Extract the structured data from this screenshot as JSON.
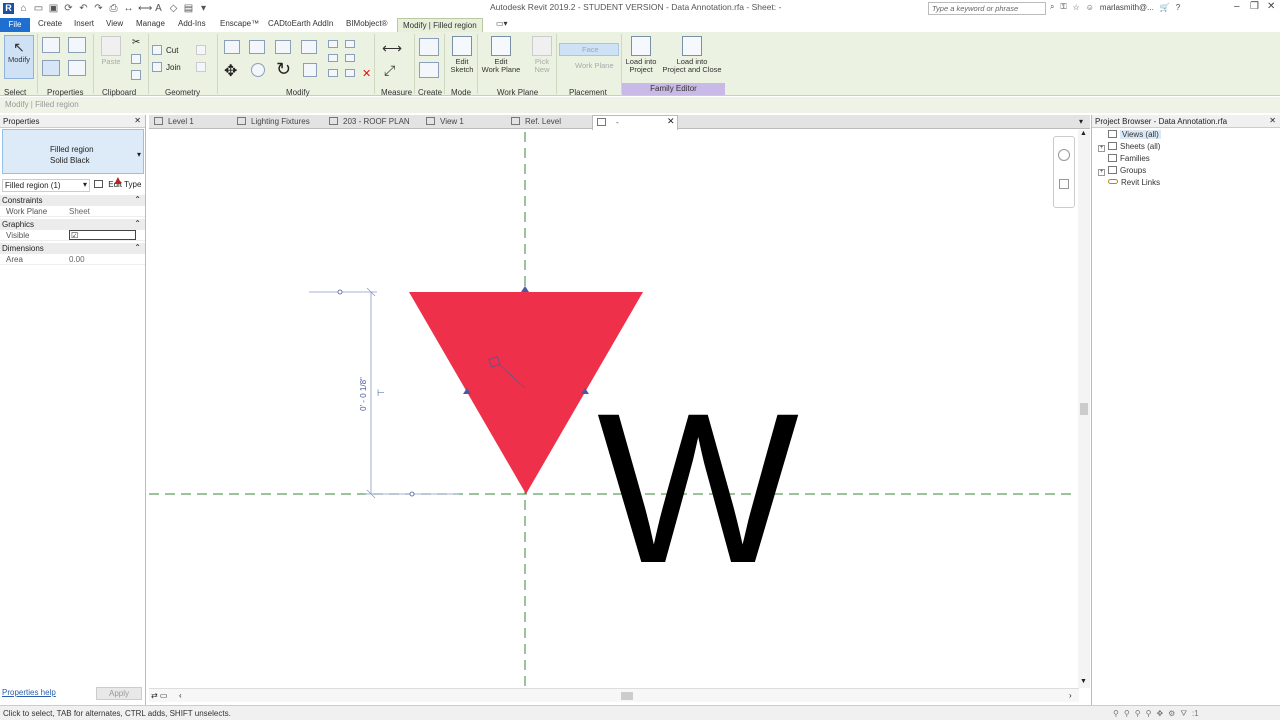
{
  "titlebar": {
    "title": "Autodesk Revit 2019.2 - STUDENT VERSION - Data Annotation.rfa - Sheet: -",
    "search_placeholder": "Type a keyword or phrase",
    "user": "marlasmith@...",
    "help": "?"
  },
  "tabs": {
    "file": "File",
    "items": [
      "Create",
      "Insert",
      "View",
      "Manage",
      "Add-Ins",
      "Enscape™",
      "CADtoEarth AddIn",
      "BIMobject®",
      "Modify | Filled region"
    ]
  },
  "ribbon": {
    "modify": "Modify",
    "paste": "Paste",
    "cut": "Cut",
    "join": "Join",
    "edit_sketch": "Edit\nSketch",
    "edit_work_plane": "Edit\nWork Plane",
    "pick_new": "Pick\nNew",
    "face": "Face",
    "work_plane": "Work Plane",
    "load_into_project": "Load into\nProject",
    "load_into_project_close": "Load into\nProject and Close",
    "groups": {
      "select": "Select",
      "properties": "Properties",
      "clipboard": "Clipboard",
      "geometry": "Geometry",
      "modify": "Modify",
      "measure": "Measure",
      "create": "Create",
      "mode": "Mode",
      "work_plane": "Work Plane",
      "placement": "Placement",
      "family_editor": "Family Editor"
    }
  },
  "context_bar": "Modify | Filled region",
  "properties": {
    "title": "Properties",
    "type_line1": "Filled region",
    "type_line2": "Solid Black",
    "instance_selector": "Filled region (1)",
    "edit_type": "Edit Type",
    "sections": {
      "constraints": "Constraints",
      "graphics": "Graphics",
      "dimensions": "Dimensions"
    },
    "rows": {
      "work_plane_label": "Work Plane",
      "work_plane_value": "Sheet",
      "visible_label": "Visible",
      "visible_checked": true,
      "area_label": "Area",
      "area_value": "0.00"
    },
    "help": "Properties help",
    "apply": "Apply"
  },
  "view_tabs": [
    {
      "label": "Level 1"
    },
    {
      "label": "Lighting Fixtures"
    },
    {
      "label": "203 - ROOF PLAN"
    },
    {
      "label": "View 1"
    },
    {
      "label": "Ref. Level"
    },
    {
      "label": "-"
    }
  ],
  "canvas": {
    "dimension_text": "0' - 0 1/8\"",
    "big_letter": "W",
    "filled_region_color": "#ee304a"
  },
  "browser": {
    "title": "Project Browser - Data Annotation.rfa",
    "items": [
      "Views (all)",
      "Sheets (all)",
      "Families",
      "Groups",
      "Revit Links"
    ]
  },
  "status": {
    "text": "Click to select, TAB for alternates, CTRL adds, SHIFT unselects.",
    "filter_count": ":1"
  }
}
